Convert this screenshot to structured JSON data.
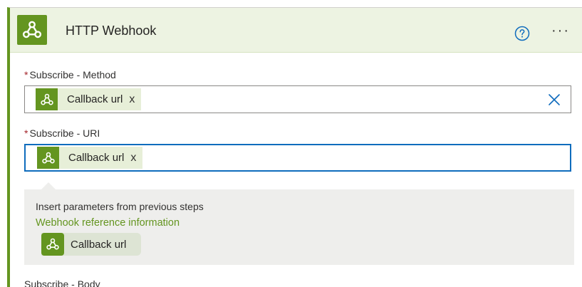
{
  "header": {
    "title": "HTTP Webhook",
    "icon": "webhook-icon",
    "help_icon": "help-circle-icon",
    "more_icon": "more-horizontal-icon",
    "more_label": "···"
  },
  "fields": {
    "method": {
      "required_mark": "*",
      "label": "Subscribe - Method",
      "token_label": "Callback url",
      "token_remove": "x",
      "clear_icon": "clear-x-icon"
    },
    "uri": {
      "required_mark": "*",
      "label": "Subscribe - URI",
      "token_label": "Callback url",
      "token_remove": "x"
    },
    "body": {
      "label": "Subscribe - Body"
    }
  },
  "dynamic_content": {
    "title": "Insert parameters from previous steps",
    "section_link": "Webhook reference information",
    "items": [
      {
        "label": "Callback url",
        "icon": "webhook-icon"
      }
    ]
  },
  "colors": {
    "brand_green": "#649520",
    "header_bg": "#edf3e2",
    "token_bg": "#e7efd8",
    "focus_blue": "#0f6cbd",
    "required_red": "#a4262c"
  }
}
